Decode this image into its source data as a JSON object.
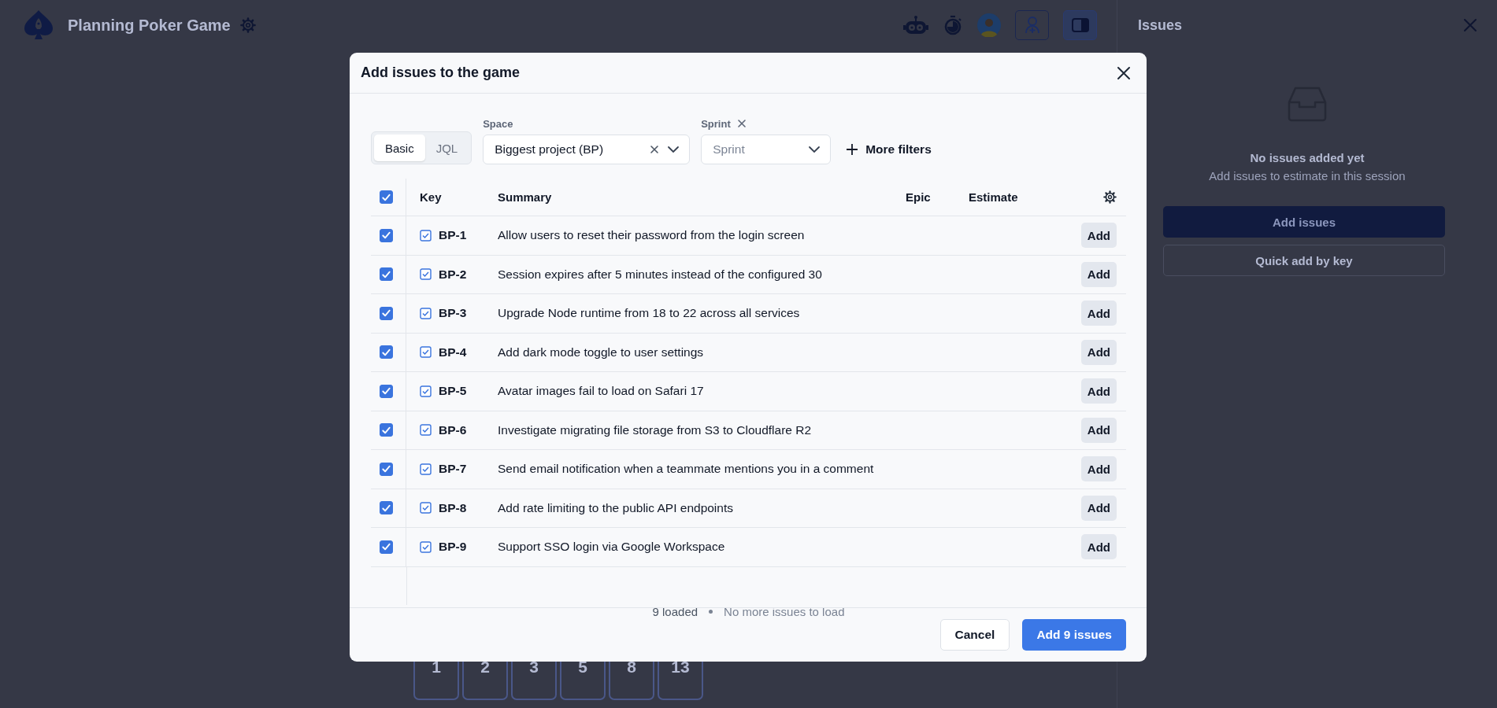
{
  "header": {
    "title": "Planning Poker Game"
  },
  "cards": [
    {
      "label": "1"
    },
    {
      "label": "2"
    },
    {
      "label": "3"
    },
    {
      "label": "5"
    },
    {
      "label": "8"
    },
    {
      "label": "13"
    }
  ],
  "issues_panel": {
    "title": "Issues",
    "empty_title": "No issues added yet",
    "empty_text": "Add issues to estimate in this session",
    "buttons": [
      {
        "label": "Add issues",
        "kind": "primary"
      },
      {
        "label": "Quick add by key",
        "kind": "secondary"
      }
    ]
  },
  "modal": {
    "title": "Add issues to the game",
    "modes": [
      {
        "label": "Basic",
        "selected": true
      },
      {
        "label": "JQL",
        "selected": false
      }
    ],
    "filters": [
      {
        "label": "Space",
        "value": "Biggest project (BP)",
        "clearable": true,
        "removable": false
      },
      {
        "label": "Sprint",
        "placeholder": "Sprint",
        "clearable": false,
        "removable": true
      }
    ],
    "more_filters": "More filters",
    "table": {
      "all_checked": true,
      "columns": [
        "Key",
        "Summary",
        "Epic",
        "Estimate"
      ],
      "rows": [
        {
          "selected": true,
          "key": "BP-1",
          "summary": "Allow users to reset their password from the login screen",
          "action": "Add"
        },
        {
          "selected": true,
          "key": "BP-2",
          "summary": "Session expires after 5 minutes instead of the configured 30",
          "action": "Add"
        },
        {
          "selected": true,
          "key": "BP-3",
          "summary": "Upgrade Node runtime from 18 to 22 across all services",
          "action": "Add"
        },
        {
          "selected": true,
          "key": "BP-4",
          "summary": "Add dark mode toggle to user settings",
          "action": "Add"
        },
        {
          "selected": true,
          "key": "BP-5",
          "summary": "Avatar images fail to load on Safari 17",
          "action": "Add"
        },
        {
          "selected": true,
          "key": "BP-6",
          "summary": "Investigate migrating file storage from S3 to Cloudflare R2",
          "action": "Add"
        },
        {
          "selected": true,
          "key": "BP-7",
          "summary": "Send email notification when a teammate mentions you in a comment",
          "action": "Add"
        },
        {
          "selected": true,
          "key": "BP-8",
          "summary": "Add rate limiting to the public API endpoints",
          "action": "Add"
        },
        {
          "selected": true,
          "key": "BP-9",
          "summary": "Support SSO login via Google Workspace",
          "action": "Add"
        }
      ]
    },
    "status": {
      "loaded": "9 loaded",
      "note": "No more issues to load"
    },
    "buttons": [
      {
        "label": "Cancel",
        "kind": "secondary"
      },
      {
        "label": "Add 9 issues",
        "kind": "primary"
      }
    ]
  }
}
